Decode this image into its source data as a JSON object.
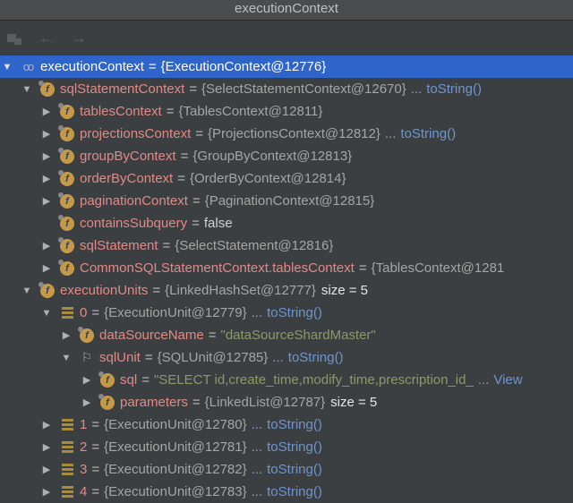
{
  "window_title": "executionContext",
  "toolbar": {
    "icons": [
      "restore-layout-icon",
      "back-arrow-icon",
      "forward-arrow-icon"
    ],
    "back": "←",
    "forward": "→"
  },
  "rows": [
    {
      "level": 0,
      "arrow": "▼",
      "icon": "glasses",
      "name": "executionContext",
      "value": "{ExecutionContext@12776}",
      "selected": true
    },
    {
      "level": 1,
      "arrow": "▼",
      "icon": "f",
      "name": "sqlStatementContext",
      "value": "{SelectStatementContext@12670}",
      "link": "toString()"
    },
    {
      "level": 2,
      "arrow": "▶",
      "icon": "f",
      "name": "tablesContext",
      "value": "{TablesContext@12811}"
    },
    {
      "level": 2,
      "arrow": "▶",
      "icon": "f",
      "name": "projectionsContext",
      "value": "{ProjectionsContext@12812}",
      "link": "toString()"
    },
    {
      "level": 2,
      "arrow": "▶",
      "icon": "f",
      "name": "groupByContext",
      "value": "{GroupByContext@12813}"
    },
    {
      "level": 2,
      "arrow": "▶",
      "icon": "f",
      "name": "orderByContext",
      "value": "{OrderByContext@12814}"
    },
    {
      "level": 2,
      "arrow": "▶",
      "icon": "f",
      "name": "paginationContext",
      "value": "{PaginationContext@12815}"
    },
    {
      "level": 2,
      "arrow": "",
      "icon": "f",
      "name": "containsSubquery",
      "value": "false",
      "kind": "bool"
    },
    {
      "level": 2,
      "arrow": "▶",
      "icon": "f",
      "name": "sqlStatement",
      "value": "{SelectStatement@12816}"
    },
    {
      "level": 2,
      "arrow": "▶",
      "icon": "f",
      "name": "CommonSQLStatementContext.tablesContext",
      "value": "{TablesContext@1281"
    },
    {
      "level": 1,
      "arrow": "▼",
      "icon": "f",
      "name": "executionUnits",
      "value": "{LinkedHashSet@12777}",
      "extra": "size = 5"
    },
    {
      "level": 2,
      "arrow": "▼",
      "icon": "list",
      "name": "0",
      "value": "{ExecutionUnit@12779}",
      "link": "toString()"
    },
    {
      "level": 3,
      "arrow": "▶",
      "icon": "f",
      "name": "dataSourceName",
      "value": "\"dataSourceShardMaster\"",
      "kind": "str"
    },
    {
      "level": 3,
      "arrow": "▼",
      "icon": "flag",
      "name": "sqlUnit",
      "value": "{SQLUnit@12785}",
      "link": "toString()"
    },
    {
      "level": 4,
      "arrow": "▶",
      "icon": "f",
      "name": "sql",
      "value": "\"SELECT  id,create_time,modify_time,prescription_id_",
      "kind": "str",
      "link": "View"
    },
    {
      "level": 4,
      "arrow": "▶",
      "icon": "f",
      "name": "parameters",
      "value": "{LinkedList@12787}",
      "extra": "size = 5"
    },
    {
      "level": 2,
      "arrow": "▶",
      "icon": "list",
      "name": "1",
      "value": "{ExecutionUnit@12780}",
      "link": "toString()"
    },
    {
      "level": 2,
      "arrow": "▶",
      "icon": "list",
      "name": "2",
      "value": "{ExecutionUnit@12781}",
      "link": "toString()"
    },
    {
      "level": 2,
      "arrow": "▶",
      "icon": "list",
      "name": "3",
      "value": "{ExecutionUnit@12782}",
      "link": "toString()"
    },
    {
      "level": 2,
      "arrow": "▶",
      "icon": "list",
      "name": "4",
      "value": "{ExecutionUnit@12783}",
      "link": "toString()"
    }
  ],
  "eq": "=",
  "dots": "..."
}
